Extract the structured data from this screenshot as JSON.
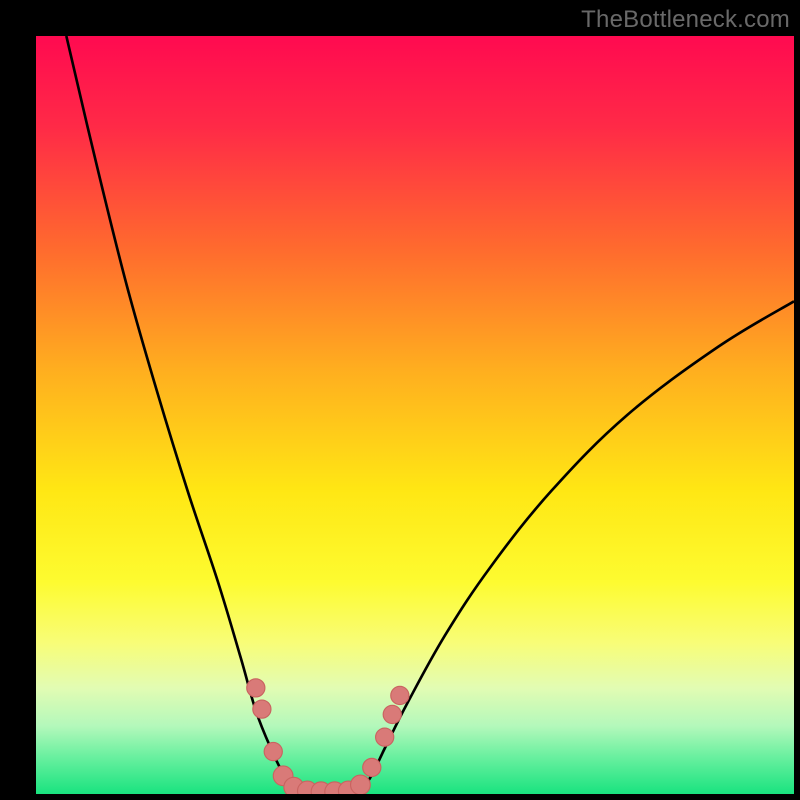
{
  "watermark": "TheBottleneck.com",
  "colors": {
    "border": "#000000",
    "curve": "#000000",
    "marker_fill": "#d97a78",
    "marker_stroke": "#c96360"
  },
  "chart_data": {
    "type": "line",
    "title": "",
    "xlabel": "",
    "ylabel": "",
    "xlim": [
      0,
      100
    ],
    "ylim": [
      0,
      100
    ],
    "gradient_bands": [
      {
        "y_pct": 0,
        "color": "#ff0a50"
      },
      {
        "y_pct": 12,
        "color": "#ff2a47"
      },
      {
        "y_pct": 28,
        "color": "#ff6a2e"
      },
      {
        "y_pct": 44,
        "color": "#ffae1f"
      },
      {
        "y_pct": 60,
        "color": "#ffe714"
      },
      {
        "y_pct": 72,
        "color": "#fdfb30"
      },
      {
        "y_pct": 80,
        "color": "#f8fd77"
      },
      {
        "y_pct": 86,
        "color": "#e2fcb3"
      },
      {
        "y_pct": 91,
        "color": "#b4f8bb"
      },
      {
        "y_pct": 95,
        "color": "#6bf0a0"
      },
      {
        "y_pct": 100,
        "color": "#19e37f"
      }
    ],
    "series": [
      {
        "name": "left-branch",
        "points": [
          {
            "x": 4,
            "y": 100
          },
          {
            "x": 8,
            "y": 83
          },
          {
            "x": 12,
            "y": 67
          },
          {
            "x": 16,
            "y": 53
          },
          {
            "x": 20,
            "y": 40
          },
          {
            "x": 24,
            "y": 28
          },
          {
            "x": 27,
            "y": 18
          },
          {
            "x": 29,
            "y": 11
          },
          {
            "x": 31,
            "y": 6
          },
          {
            "x": 33,
            "y": 2
          },
          {
            "x": 35,
            "y": 0
          }
        ]
      },
      {
        "name": "right-branch",
        "points": [
          {
            "x": 42,
            "y": 0
          },
          {
            "x": 44,
            "y": 2
          },
          {
            "x": 46,
            "y": 6
          },
          {
            "x": 49,
            "y": 12
          },
          {
            "x": 54,
            "y": 21
          },
          {
            "x": 60,
            "y": 30
          },
          {
            "x": 68,
            "y": 40
          },
          {
            "x": 78,
            "y": 50
          },
          {
            "x": 90,
            "y": 59
          },
          {
            "x": 100,
            "y": 65
          }
        ]
      }
    ],
    "floor_segment": {
      "x0": 35,
      "x1": 42,
      "y": 0
    },
    "markers": [
      {
        "x": 29.0,
        "y": 14.0,
        "r": 1.2
      },
      {
        "x": 29.8,
        "y": 11.2,
        "r": 1.2
      },
      {
        "x": 31.3,
        "y": 5.6,
        "r": 1.2
      },
      {
        "x": 32.6,
        "y": 2.4,
        "r": 1.3
      },
      {
        "x": 34.0,
        "y": 0.9,
        "r": 1.3
      },
      {
        "x": 35.8,
        "y": 0.4,
        "r": 1.3
      },
      {
        "x": 37.6,
        "y": 0.3,
        "r": 1.3
      },
      {
        "x": 39.4,
        "y": 0.3,
        "r": 1.3
      },
      {
        "x": 41.2,
        "y": 0.4,
        "r": 1.3
      },
      {
        "x": 42.8,
        "y": 1.2,
        "r": 1.3
      },
      {
        "x": 44.3,
        "y": 3.5,
        "r": 1.2
      },
      {
        "x": 46.0,
        "y": 7.5,
        "r": 1.2
      },
      {
        "x": 47.0,
        "y": 10.5,
        "r": 1.2
      },
      {
        "x": 48.0,
        "y": 13.0,
        "r": 1.2
      }
    ]
  }
}
